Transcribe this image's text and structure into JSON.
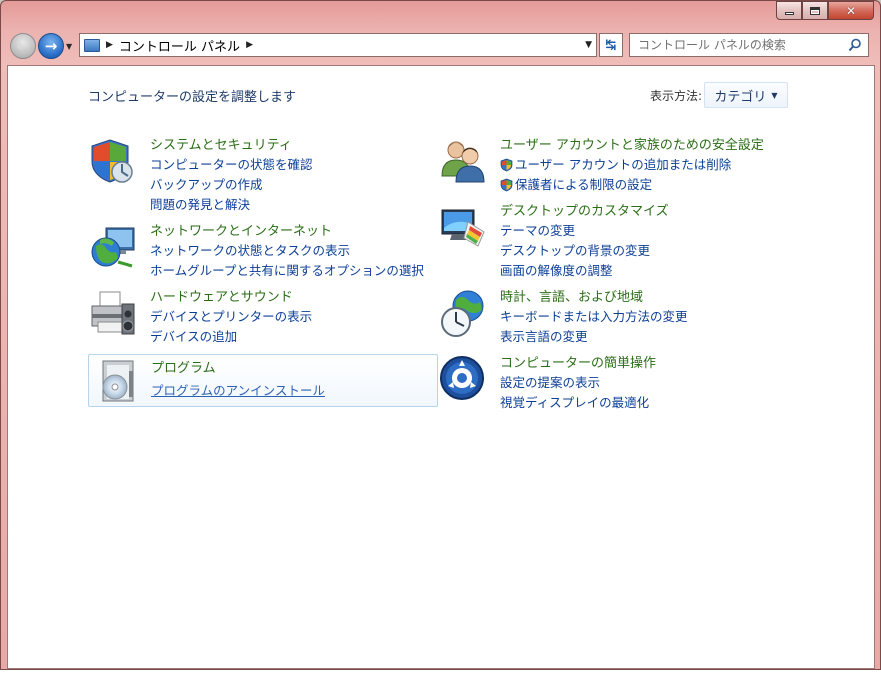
{
  "window": {
    "address": {
      "location_label": "コントロール パネル"
    },
    "search": {
      "placeholder": "コントロール パネルの検索"
    }
  },
  "content": {
    "header": "コンピューターの設定を調整します",
    "view_by_label": "表示方法:",
    "view_by_value": "カテゴリ",
    "categories": [
      {
        "icon": "shield-icon",
        "title": "システムとセキュリティ",
        "links": [
          "コンピューターの状態を確認",
          "バックアップの作成",
          "問題の発見と解決"
        ]
      },
      {
        "icon": "network-globe-icon",
        "title": "ネットワークとインターネット",
        "links": [
          "ネットワークの状態とタスクの表示",
          "ホームグループと共有に関するオプションの選択"
        ]
      },
      {
        "icon": "printer-icon",
        "title": "ハードウェアとサウンド",
        "links": [
          "デバイスとプリンターの表示",
          "デバイスの追加"
        ]
      },
      {
        "icon": "programs-icon",
        "title": "プログラム",
        "links": [
          "プログラムのアンインストール"
        ]
      },
      {
        "icon": "users-icon",
        "title": "ユーザー アカウントと家族のための安全設定",
        "links": [
          "ユーザー アカウントの追加または削除",
          "保護者による制限の設定"
        ]
      },
      {
        "icon": "desktop-icon",
        "title": "デスクトップのカスタマイズ",
        "links": [
          "テーマの変更",
          "デスクトップの背景の変更",
          "画面の解像度の調整"
        ]
      },
      {
        "icon": "clock-globe-icon",
        "title": "時計、言語、および地域",
        "links": [
          "キーボードまたは入力方法の変更",
          "表示言語の変更"
        ]
      },
      {
        "icon": "ease-of-access-icon",
        "title": "コンピューターの簡単操作",
        "links": [
          "設定の提案の表示",
          "視覚ディスプレイの最適化"
        ]
      }
    ]
  },
  "colors": {
    "category_title": "#2a6e16",
    "link": "#0c3f96",
    "frame": "#e9a9a6"
  }
}
